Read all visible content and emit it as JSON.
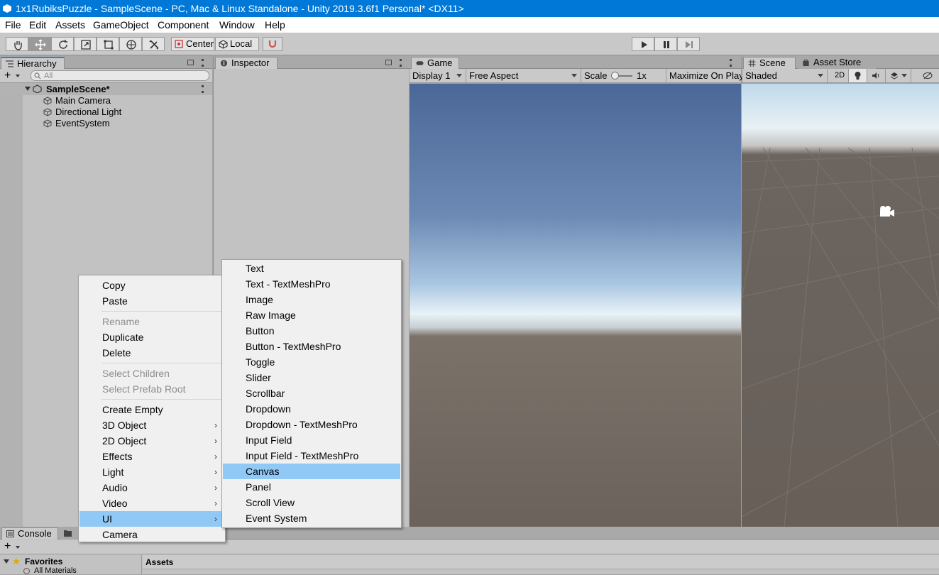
{
  "window": {
    "title": "1x1RubiksPuzzle - SampleScene - PC, Mac & Linux Standalone - Unity 2019.3.6f1 Personal* <DX11>"
  },
  "menubar": [
    "File",
    "Edit",
    "Assets",
    "GameObject",
    "Component",
    "Window",
    "Help"
  ],
  "toolbar": {
    "pivot_label": "Center",
    "space_label": "Local"
  },
  "hierarchy": {
    "tab_label": "Hierarchy",
    "search_placeholder": "All",
    "scene_name": "SampleScene*",
    "items": [
      "Main Camera",
      "Directional Light",
      "EventSystem"
    ]
  },
  "inspector": {
    "tab_label": "Inspector"
  },
  "game": {
    "tab_label": "Game",
    "display": "Display 1",
    "aspect": "Free Aspect",
    "scale_label": "Scale",
    "scale_value": "1x",
    "maximize": "Maximize On Play"
  },
  "scene": {
    "tab_label": "Scene",
    "store_tab_label": "Asset Store",
    "shading": "Shaded",
    "mode_2d": "2D"
  },
  "context_menu": {
    "items": [
      {
        "label": "Copy",
        "disabled": false
      },
      {
        "label": "Paste",
        "disabled": false
      },
      {
        "label": "Rename",
        "disabled": true
      },
      {
        "label": "Duplicate",
        "disabled": false
      },
      {
        "label": "Delete",
        "disabled": false
      },
      {
        "label": "Select Children",
        "disabled": true
      },
      {
        "label": "Select Prefab Root",
        "disabled": true
      },
      {
        "label": "Create Empty",
        "disabled": false
      },
      {
        "label": "3D Object",
        "disabled": false
      },
      {
        "label": "2D Object",
        "disabled": false
      },
      {
        "label": "Effects",
        "disabled": false
      },
      {
        "label": "Light",
        "disabled": false
      },
      {
        "label": "Audio",
        "disabled": false
      },
      {
        "label": "Video",
        "disabled": false
      },
      {
        "label": "UI",
        "disabled": false
      },
      {
        "label": "Camera",
        "disabled": false
      }
    ],
    "highlighted": "UI"
  },
  "ui_submenu": {
    "items": [
      "Text",
      "Text - TextMeshPro",
      "Image",
      "Raw Image",
      "Button",
      "Button - TextMeshPro",
      "Toggle",
      "Slider",
      "Scrollbar",
      "Dropdown",
      "Dropdown - TextMeshPro",
      "Input Field",
      "Input Field - TextMeshPro",
      "Canvas",
      "Panel",
      "Scroll View",
      "Event System"
    ],
    "highlighted": "Canvas"
  },
  "bottom": {
    "console_tab": "Console",
    "favorites_label": "Favorites",
    "favorites_item": "All Materials",
    "assets_label": "Assets"
  },
  "colors": {
    "titlebar": "#0078d7",
    "highlight": "#90c8f6"
  }
}
